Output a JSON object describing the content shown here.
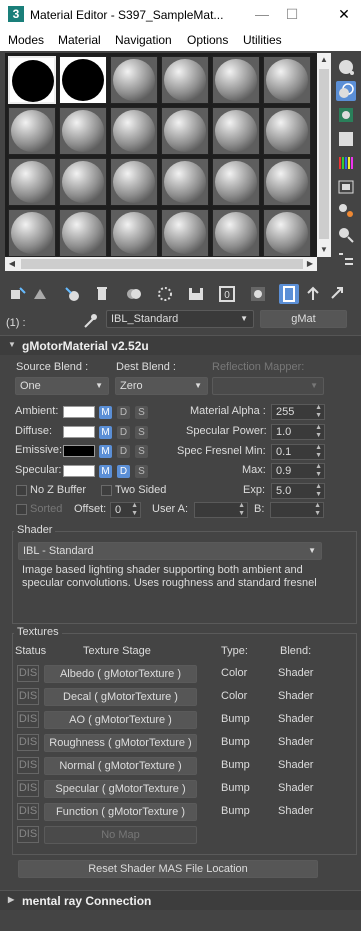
{
  "window": {
    "app_icon": "3",
    "title": "Material Editor - S397_SampleMat...",
    "minimize": "—",
    "maximize": "☐",
    "close": "✕"
  },
  "menu": [
    "Modes",
    "Material",
    "Navigation",
    "Options",
    "Utilities"
  ],
  "slots": {
    "rows": 4,
    "cols": 6,
    "black_slots": [
      0,
      1
    ],
    "selected_slot": 0
  },
  "toolbar_icons": [
    "get-material-icon",
    "assign-to-scene-icon",
    "assign-to-selection-icon",
    "reset-map-icon",
    "make-copy-icon",
    "make-unique-icon",
    "put-to-library-icon",
    "material-id-channel-icon",
    "show-shaded-icon",
    "show-end-result-icon",
    "go-to-parent-icon",
    "go-forward-to-sibling-icon"
  ],
  "name_row": {
    "level": "(1) :",
    "material_name": "IBL_Standard",
    "type_button": "gMat"
  },
  "gmotor": {
    "header": "gMotorMaterial v2.52u",
    "source_blend_label": "Source Blend :",
    "source_blend_value": "One",
    "dest_blend_label": "Dest Blend :",
    "dest_blend_value": "Zero",
    "reflection_mapper_label": "Reflection Mapper:",
    "reflection_mapper_value": "",
    "colors": [
      {
        "label": "Ambient:",
        "color": "#ffffff"
      },
      {
        "label": "Diffuse:",
        "color": "#ffffff"
      },
      {
        "label": "Emissive:",
        "color": "#000000"
      },
      {
        "label": "Specular:",
        "color": "#ffffff"
      }
    ],
    "mds": [
      "M",
      "D",
      "S"
    ],
    "material_alpha_label": "Material Alpha :",
    "material_alpha_value": "255",
    "specular_power_label": "Specular Power:",
    "specular_power_value": "1.0",
    "spec_fresnel_label": "Spec Fresnel  Min:",
    "spec_fresnel_min": "0.1",
    "max_label": "Max:",
    "max_value": "0.9",
    "exp_label": "Exp:",
    "exp_value": "5.0",
    "no_z_buffer": "No Z Buffer",
    "two_sided": "Two Sided",
    "sorted": "Sorted",
    "offset_label": "Offset:",
    "offset_value": "0",
    "user_label": "User  A:",
    "user_a_value": "",
    "b_label": "B:",
    "b_value": ""
  },
  "shader": {
    "title": "Shader",
    "value": "IBL - Standard",
    "description": "Image based lighting shader supporting both ambient and specular convolutions. Uses roughness and standard fresnel"
  },
  "textures": {
    "title": "Textures",
    "col_status": "Status",
    "col_stage": "Texture Stage",
    "col_type": "Type:",
    "col_blend": "Blend:",
    "rows": [
      {
        "status": "DIS",
        "stage": "Albedo  ( gMotorTexture )",
        "type": "Color",
        "blend": "Shader"
      },
      {
        "status": "DIS",
        "stage": "Decal  ( gMotorTexture )",
        "type": "Color",
        "blend": "Shader"
      },
      {
        "status": "DIS",
        "stage": "AO  ( gMotorTexture )",
        "type": "Bump",
        "blend": "Shader"
      },
      {
        "status": "DIS",
        "stage": "Roughness  ( gMotorTexture )",
        "type": "Bump",
        "blend": "Shader"
      },
      {
        "status": "DIS",
        "stage": "Normal  ( gMotorTexture )",
        "type": "Bump",
        "blend": "Shader"
      },
      {
        "status": "DIS",
        "stage": "Specular  ( gMotorTexture )",
        "type": "Bump",
        "blend": "Shader"
      },
      {
        "status": "DIS",
        "stage": "Function  ( gMotorTexture )",
        "type": "Bump",
        "blend": "Shader"
      },
      {
        "status": "DIS",
        "stage": "No Map",
        "type": "",
        "blend": ""
      }
    ],
    "reset_button": "Reset Shader MAS File Location"
  },
  "mental_ray": {
    "header": "mental ray Connection"
  },
  "colors": {
    "accent": "#5b8fd6",
    "panel": "#444444",
    "slot_bg": "#1e1e1e"
  }
}
